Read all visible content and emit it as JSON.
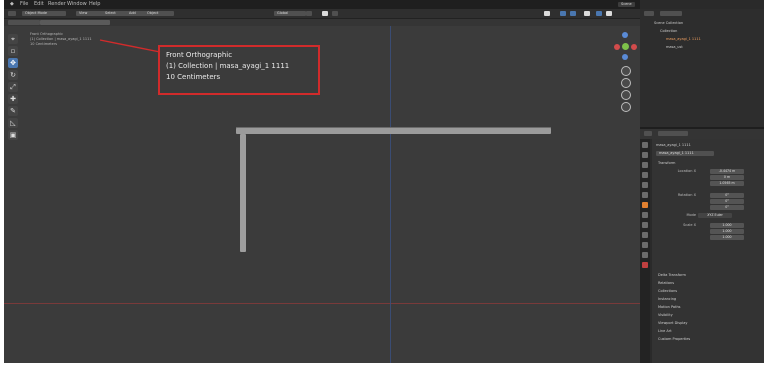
{
  "colors": {
    "viewport_bg": "#3b3b3b",
    "callout_border": "#d12b2b",
    "x_axis": "#8a3b3b",
    "z_axis": "#3b4f7a",
    "accent": "#4a77b0"
  },
  "topbar": {
    "menu_items": [
      "File",
      "Edit",
      "Render",
      "Window",
      "Help"
    ],
    "workspace_tabs": [
      "Layout",
      "Modeling",
      "Sculpting",
      "UV Editing",
      "Texture Paint",
      "Shading",
      "Animation",
      "Rendering",
      "Compositing",
      "Scripting"
    ],
    "scene": "Scene",
    "view_layer": "View Layer"
  },
  "viewport_header": {
    "mode": "Object Mode",
    "view": "View",
    "select": "Select",
    "add": "Add",
    "object": "Object",
    "transform": "Global"
  },
  "overlay": {
    "view_name": "Front Orthographic",
    "collection_line": "(1) Collection | masa_ayagi_1 1111",
    "units_line": "10 Centimeters"
  },
  "toolbar_icons": [
    "cursor-icon",
    "select-box-icon",
    "move-icon",
    "rotate-icon",
    "scale-icon",
    "transform-icon",
    "annotate-icon",
    "measure-icon",
    "add-cube-icon"
  ],
  "outliner": {
    "root": "Scene Collection",
    "collection": "Collection",
    "objects": [
      "masa_ayagi_1 1111",
      "masa_ust"
    ]
  },
  "properties": {
    "object_name": "masa_ayagi_1 1111",
    "section_transform": "Transform",
    "location_label": "Location X",
    "location_values": [
      "-0.4474 m",
      "0 m",
      "1.0565 m"
    ],
    "rotation_label": "Rotation X",
    "rotation_values": [
      "0°",
      "0°",
      "0°"
    ],
    "mode_label": "Mode",
    "mode_value": "XYZ Euler",
    "scale_label": "Scale X",
    "scale_values": [
      "1.000",
      "1.000",
      "1.000"
    ],
    "collapsed_sections": [
      "Delta Transform",
      "Relations",
      "Collections",
      "Instancing",
      "Motion Paths",
      "Visibility",
      "Viewport Display",
      "Line Art",
      "Custom Properties"
    ]
  }
}
